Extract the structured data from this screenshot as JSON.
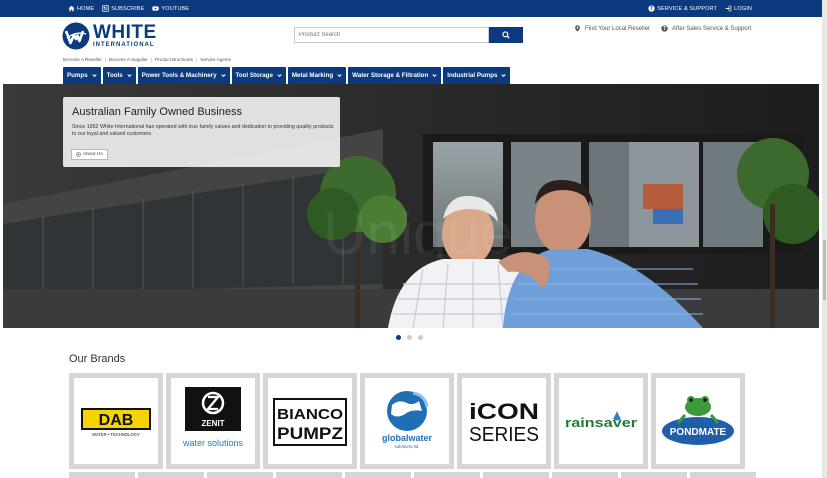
{
  "topbar": {
    "home": "HOME",
    "subscribe": "SUBSCRIBE",
    "youtube": "YOUTUBE",
    "service": "SERVICE & SUPPORT",
    "login": "LOGIN"
  },
  "logo": {
    "brand": "WHITE",
    "sub": "INTERNATIONAL"
  },
  "search": {
    "placeholder": "Product Search"
  },
  "header_links": {
    "reseller": "Find Your Local Reseller",
    "after_sales": "After Sales Service & Support"
  },
  "sublinks": [
    "Become A Reseller",
    "Become A Supplier",
    "Product Brochures",
    "Service Agents"
  ],
  "nav": [
    "Pumps",
    "Tools",
    "Power Tools & Machinery",
    "Tool Storage",
    "Metal Marking",
    "Water Storage & Filtration",
    "Industrial Pumps"
  ],
  "hero": {
    "title": "Australian Family Owned Business",
    "text": "Since 1952 White International has operated with true family values and dedication to providing quality products to our loyal and valued customers",
    "button": "About Us"
  },
  "brands": {
    "title": "Our Brands",
    "dab": {
      "name": "DAB",
      "tagline": "WATER • TECHNOLOGY"
    },
    "zenit": {
      "name": "ZENIT",
      "tagline": "water solutions"
    },
    "bianco": {
      "line1": "BIANCO",
      "line2": "PUMPZ"
    },
    "globalwater": {
      "name": "globalwater",
      "sub": "solutions ltd."
    },
    "icon": {
      "line1": "iCON",
      "line2": "SERIES"
    },
    "rainsaver": {
      "name": "rainsaver"
    },
    "pondmate": {
      "name": "PONDMATE"
    }
  },
  "colors": {
    "brand_blue": "#0b3a7e"
  },
  "slider": {
    "slides": 3,
    "active": 1
  }
}
